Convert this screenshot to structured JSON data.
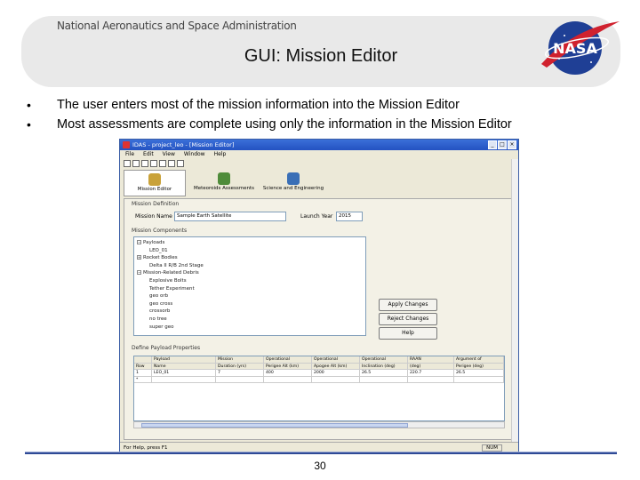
{
  "slide": {
    "agency": "National Aeronautics and Space Administration",
    "title": "GUI: Mission Editor",
    "logo_text": "NASA",
    "page_number": "30",
    "bullets": [
      "The user enters most of the mission information into the Mission Editor",
      "Most assessments are complete using only the information in the Mission Editor"
    ],
    "bullet_glyph": "•"
  },
  "window": {
    "title": "IDAS - project_leo - [Mission Editor]",
    "controls": [
      "_",
      "□",
      "×"
    ],
    "menu": [
      "File",
      "Edit",
      "View",
      "Window",
      "Help"
    ],
    "toolbar_icons": [
      "save-icon",
      "open-icon",
      "cut-icon",
      "copy-icon",
      "paste-icon",
      "print-icon",
      "grid-icon"
    ],
    "modes": [
      {
        "label": "Mission Editor",
        "icon": "mission-editor-icon",
        "color": "#c9a23a"
      },
      {
        "label": "Meteoroids Assessments",
        "icon": "meteoroid-icon",
        "color": "#4f8c3a"
      },
      {
        "label": "Science and Engineering",
        "icon": "science-icon",
        "color": "#3a6fb6"
      }
    ],
    "mission_definition": {
      "group_label": "Mission Definition",
      "name_label": "Mission Name",
      "name_value": "Sample Earth Satellite",
      "year_label": "Launch Year",
      "year_value": "2015"
    },
    "components": {
      "group_label": "Mission Components",
      "tree": [
        {
          "label": "Payloads",
          "expander": "−"
        },
        {
          "label": "LEO_01",
          "expander": ""
        },
        {
          "label": "Rocket Bodies",
          "expander": "+"
        },
        {
          "label": "Delta II R/B 2nd Stage",
          "expander": ""
        },
        {
          "label": "Mission-Related Debris",
          "expander": "−"
        },
        {
          "label": "Explosive Bolts",
          "expander": ""
        },
        {
          "label": "Tether Experiment",
          "expander": ""
        },
        {
          "label": "geo orb",
          "expander": ""
        },
        {
          "label": "geo cross",
          "expander": ""
        },
        {
          "label": "crossorb",
          "expander": ""
        },
        {
          "label": "no tree",
          "expander": ""
        },
        {
          "label": "super geo",
          "expander": ""
        }
      ]
    },
    "buttons": {
      "apply": "Apply Changes",
      "reject": "Reject Changes",
      "help": "Help"
    },
    "table": {
      "group_label": "Define Payload Properties",
      "header_top": [
        "",
        "Payload",
        "Mission",
        "Operational",
        "Operational",
        "Operational",
        "RAAN",
        "Argument of"
      ],
      "header_bottom": [
        "Row",
        "Name",
        "Duration (yrs)",
        "Perigee Alt (km)",
        "Apogee Alt (km)",
        "Inclination (deg)",
        "(deg)",
        "Perigee (deg)"
      ],
      "rows": [
        [
          "1",
          "LEO_01",
          "7",
          "400",
          "2000",
          "26.5",
          "220.7",
          "26.5"
        ],
        [
          "*",
          "",
          "",
          "",
          "",
          "",
          "",
          ""
        ]
      ]
    },
    "status": {
      "text": "For Help, press F1",
      "num": "NUM"
    }
  }
}
